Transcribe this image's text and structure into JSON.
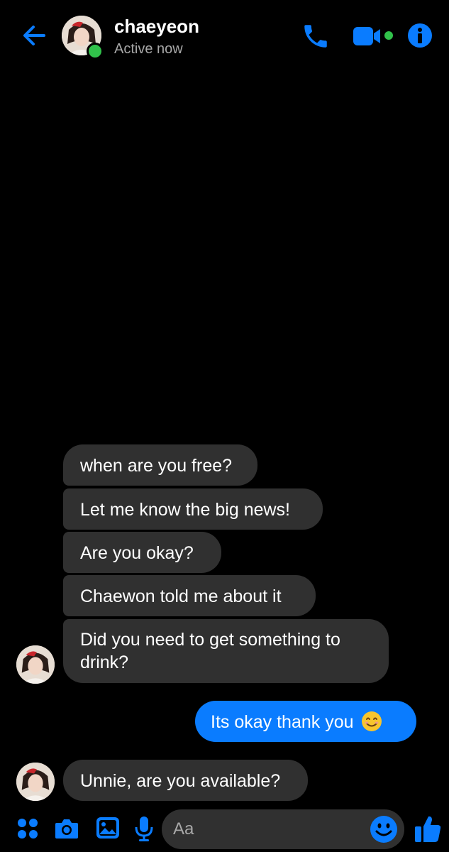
{
  "header": {
    "name": "chaeyeon",
    "status": "Active now"
  },
  "messages": [
    {
      "from": "them",
      "text": "when are you free?"
    },
    {
      "from": "them",
      "text": "Let me know the big news!"
    },
    {
      "from": "them",
      "text": "Are you okay?"
    },
    {
      "from": "them",
      "text": "Chaewon told me about it"
    },
    {
      "from": "them",
      "text": "Did you need to get something to drink?"
    },
    {
      "from": "me",
      "text": "Its okay thank you"
    },
    {
      "from": "them",
      "text": "Unnie, are you available?"
    }
  ],
  "composer": {
    "placeholder": "Aa"
  },
  "icons": {
    "back": "arrow-left-icon",
    "call": "phone-icon",
    "video": "video-camera-icon",
    "info": "info-icon",
    "apps": "four-dots-icon",
    "camera": "camera-icon",
    "gallery": "image-icon",
    "voice": "microphone-icon",
    "emoji": "smiley-icon",
    "like": "thumbs-up-icon"
  },
  "colors": {
    "accent": "#0a7cff",
    "background": "#000000",
    "incoming_bubble": "#303030",
    "active": "#31c24b"
  }
}
